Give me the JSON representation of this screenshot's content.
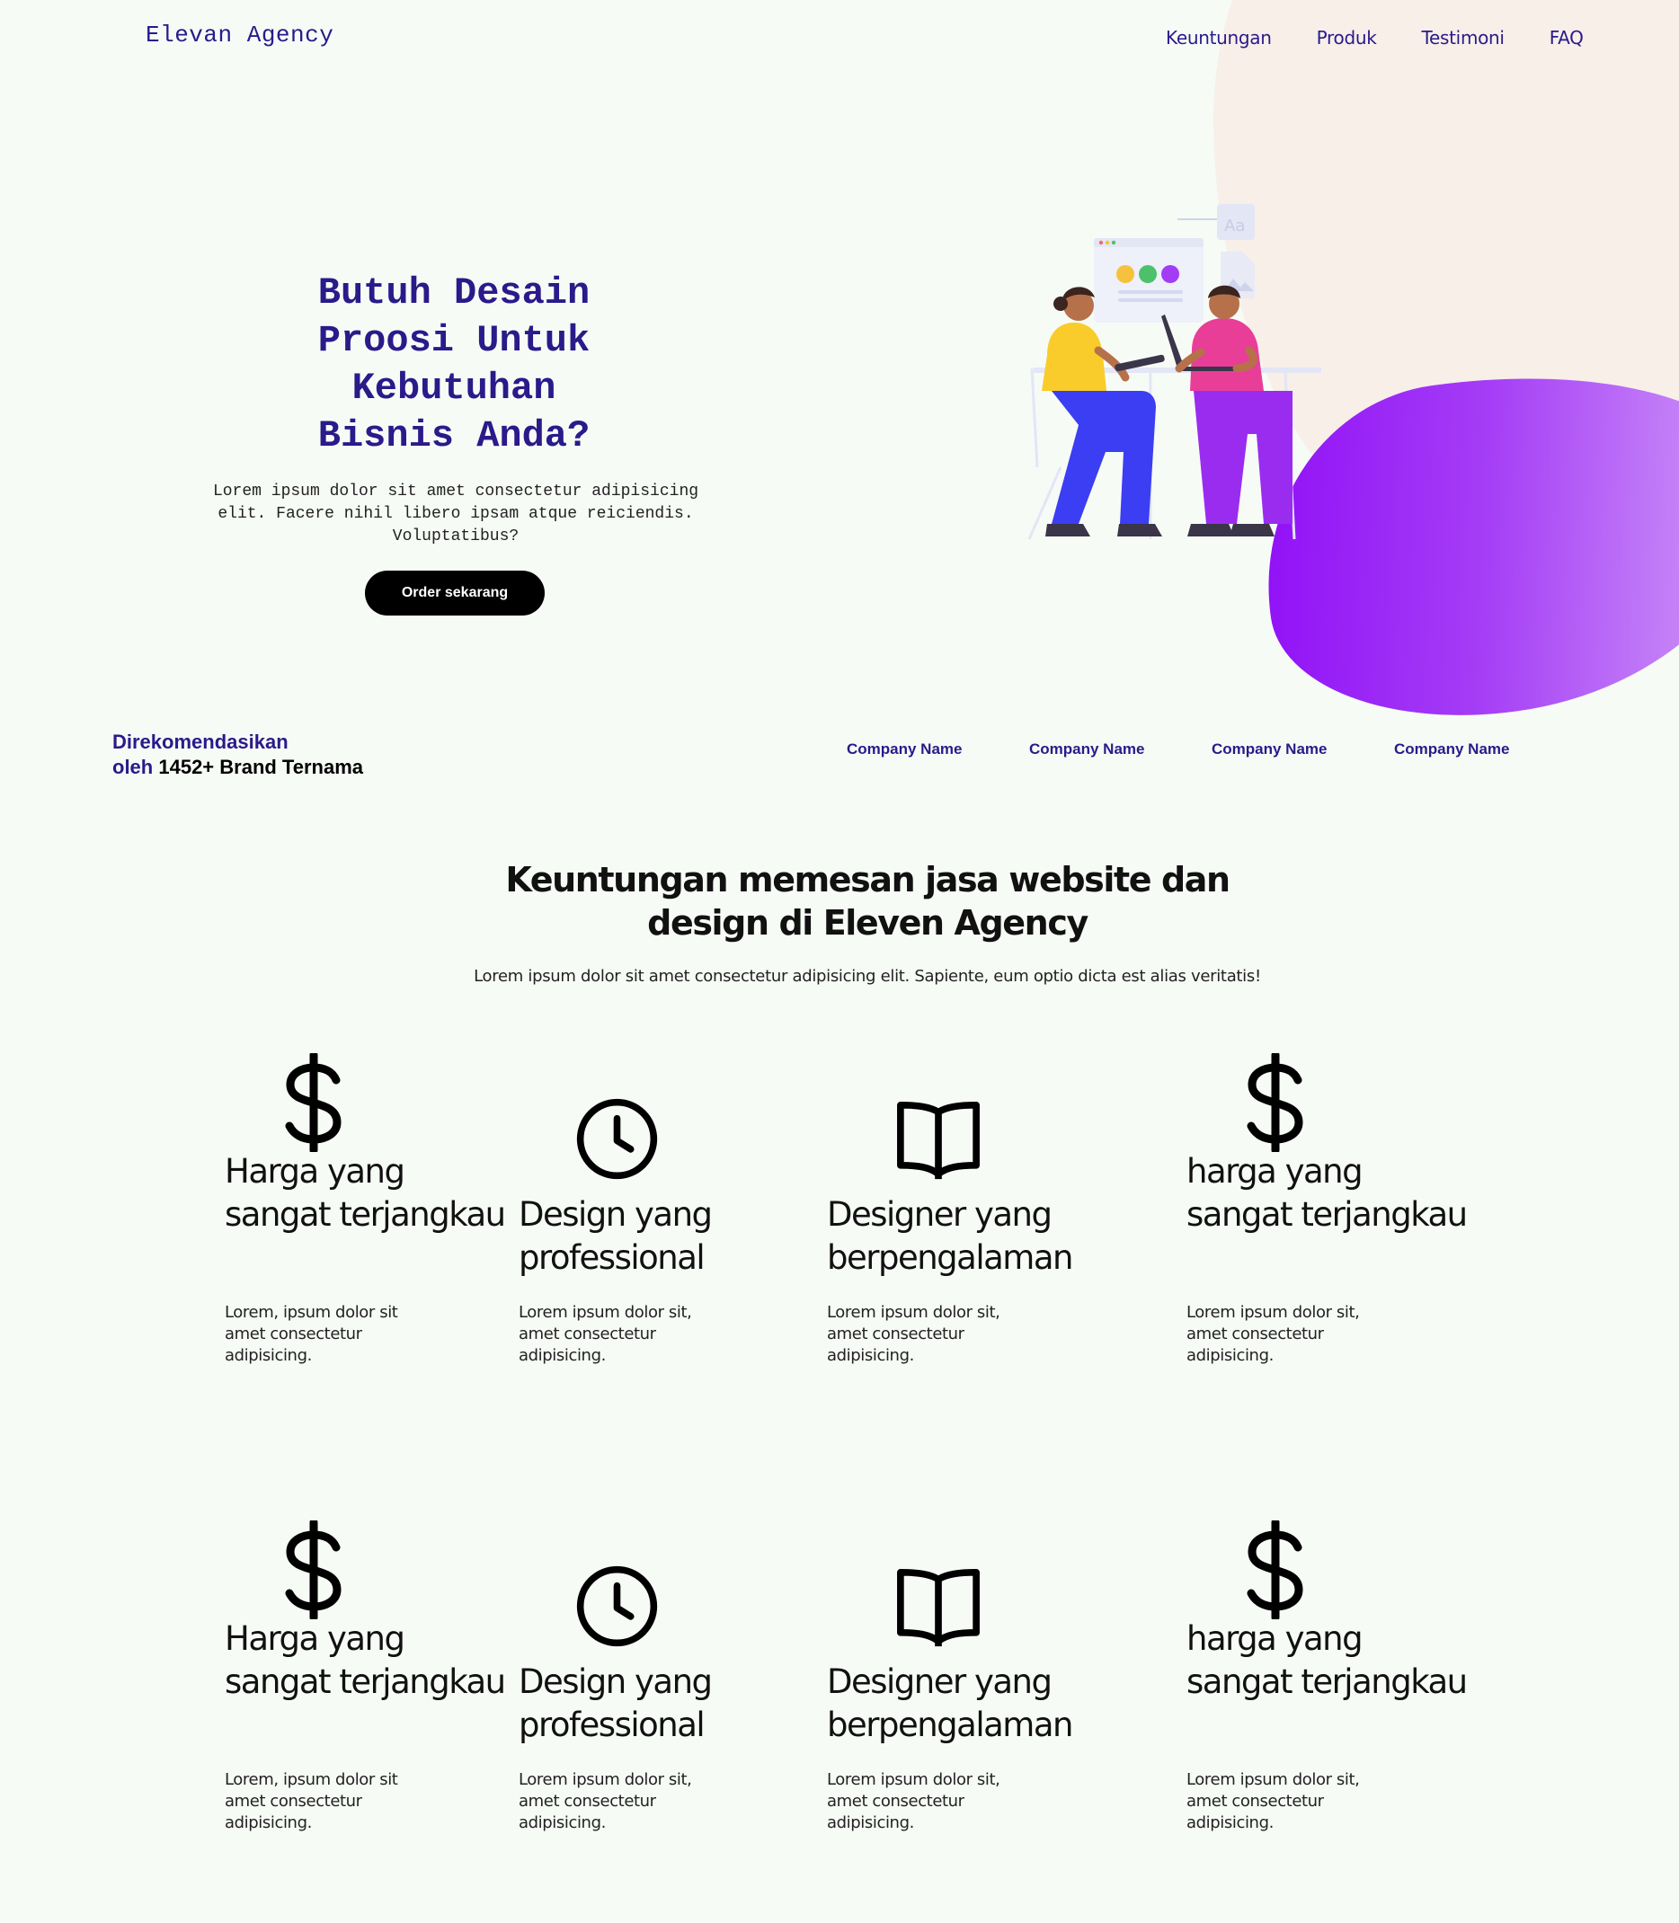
{
  "brand": "Elevan Agency",
  "nav": [
    "Keuntungan",
    "Produk",
    "Testimoni",
    "FAQ"
  ],
  "hero": {
    "title": "Butuh Desain Proosi Untuk Kebutuhan Bisnis Anda?",
    "text": "Lorem ipsum dolor sit amet consectetur adipisicing elit. Facere nihil libero ipsam atque reiciendis. Voluptatibus?",
    "button": "Order sekarang"
  },
  "recommended": {
    "line1": "Direkomendasikan",
    "prefix": "oleh",
    "highlight": "1452+ Brand Ternama"
  },
  "companies": [
    "Company Name",
    "Company Name",
    "Company Name",
    "Company Name"
  ],
  "benefits": {
    "title": "Keuntungan memesan jasa website dan design di Eleven Agency",
    "subtitle": "Lorem ipsum dolor sit amet consectetur adipisicing elit. Sapiente, eum optio dicta est alias veritatis!",
    "cards": [
      {
        "icon": "dollar-icon",
        "title": "Harga yang sangat terjangkau",
        "desc": "Lorem, ipsum dolor sit amet consectetur adipisicing."
      },
      {
        "icon": "clock-icon",
        "title": "Design yang professional",
        "desc": "Lorem ipsum dolor sit, amet consectetur adipisicing."
      },
      {
        "icon": "book-icon",
        "title": "Designer yang berpengalaman",
        "desc": "Lorem ipsum dolor sit, amet consectetur adipisicing."
      },
      {
        "icon": "dollar-icon",
        "title": "harga yang sangat terjangkau",
        "desc": "Lorem ipsum dolor sit, amet consectetur adipisicing."
      },
      {
        "icon": "dollar-icon",
        "title": "Harga yang sangat terjangkau",
        "desc": "Lorem, ipsum dolor sit amet consectetur adipisicing."
      },
      {
        "icon": "clock-icon",
        "title": "Design yang professional",
        "desc": "Lorem ipsum dolor sit, amet consectetur adipisicing."
      },
      {
        "icon": "book-icon",
        "title": "Designer yang berpengalaman",
        "desc": "Lorem ipsum dolor sit, amet consectetur adipisicing."
      },
      {
        "icon": "dollar-icon",
        "title": "harga yang sangat terjangkau",
        "desc": "Lorem ipsum dolor sit, amet consectetur adipisicing."
      }
    ]
  },
  "colors": {
    "background": "#f7fbf6",
    "primary": "#2a1a8a",
    "accent_purple": "#8f0cf7",
    "peach": "#f7efe8"
  }
}
